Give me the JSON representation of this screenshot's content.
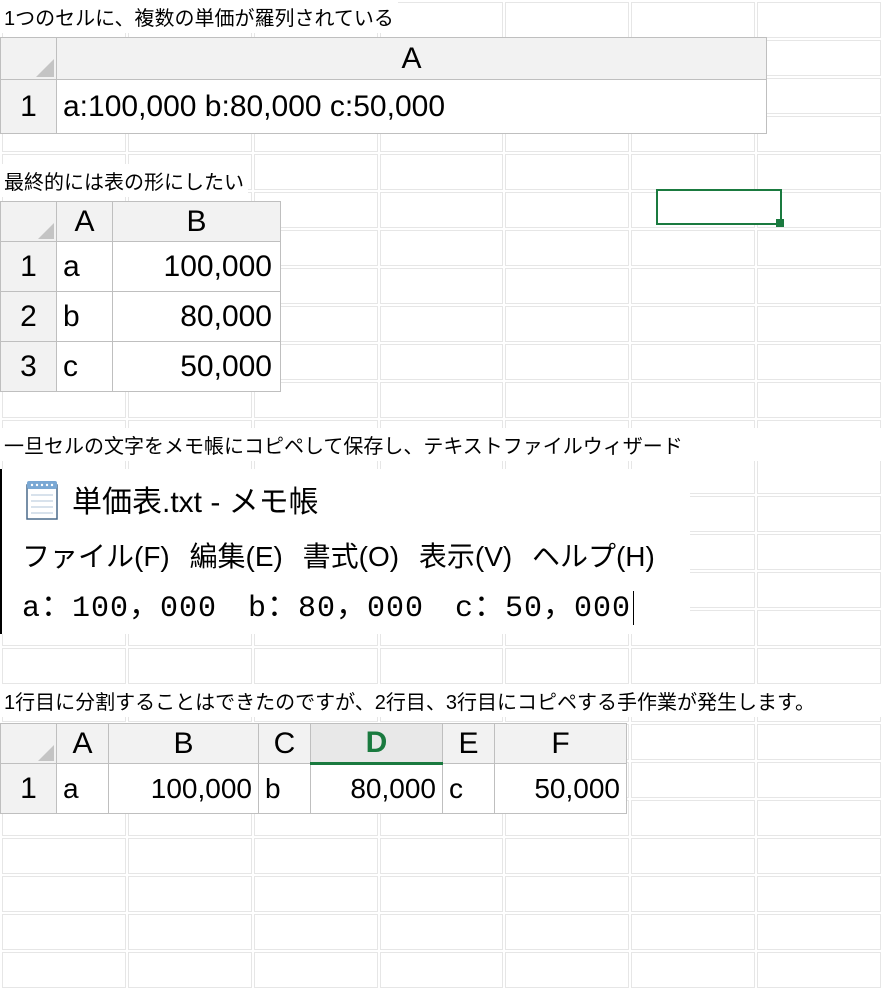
{
  "captions": {
    "c1": "1つのセルに、複数の単価が羅列されている",
    "c2": "最終的には表の形にしたい",
    "c3": "一旦セルの文字をメモ帳にコピペして保存し、テキストファイルウィザード",
    "c4": "1行目に分割することはできたのですが、2行目、3行目にコピペする手作業が発生します。"
  },
  "sheet1": {
    "colA": "A",
    "row1": "1",
    "cell": "a:100,000 b:80,000 c:50,000"
  },
  "sheet2": {
    "colA": "A",
    "colB": "B",
    "rows": [
      {
        "n": "1",
        "a": "a",
        "b": "100,000"
      },
      {
        "n": "2",
        "a": "b",
        "b": "80,000"
      },
      {
        "n": "3",
        "a": "c",
        "b": "50,000"
      }
    ]
  },
  "notepad": {
    "title": "単価表.txt - メモ帳",
    "menu": {
      "file": "ファイル(F)",
      "edit": "編集(E)",
      "format": "書式(O)",
      "view": "表示(V)",
      "help": "ヘルプ(H)"
    },
    "content": "a：100，000　b：80，000　c：50，000"
  },
  "sheet3": {
    "cols": {
      "a": "A",
      "b": "B",
      "c": "C",
      "d": "D",
      "e": "E",
      "f": "F"
    },
    "row1": "1",
    "cells": {
      "a": "a",
      "b": "100,000",
      "c": "b",
      "d": "80,000",
      "e": "c",
      "f": "50,000"
    }
  },
  "chart_data": {
    "type": "table",
    "title": "単価表",
    "categories": [
      "a",
      "b",
      "c"
    ],
    "values": [
      100000,
      80000,
      50000
    ]
  }
}
